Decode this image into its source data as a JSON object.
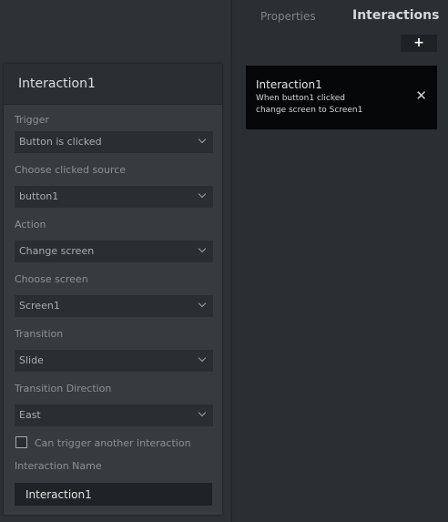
{
  "tabs": {
    "properties": "Properties",
    "interactions": "Interactions"
  },
  "add_button": {
    "label": "+",
    "icon": "plus-icon"
  },
  "interactions": [
    {
      "title": "Interaction1",
      "desc_line1": "When button1 clicked",
      "desc_line2": "change screen to Screen1",
      "close_label": "✕"
    }
  ],
  "editor": {
    "title": "Interaction1",
    "trigger": {
      "label": "Trigger",
      "value": "Button is clicked"
    },
    "source": {
      "label": "Choose clicked source",
      "value": "button1"
    },
    "action": {
      "label": "Action",
      "value": "Change screen"
    },
    "screen": {
      "label": "Choose screen",
      "value": "Screen1"
    },
    "transition": {
      "label": "Transition",
      "value": "Slide"
    },
    "direction": {
      "label": "Transition Direction",
      "value": "East"
    },
    "chain_checkbox": {
      "label": "Can trigger another interaction",
      "checked": false
    },
    "name": {
      "label": "Interaction Name",
      "value": "Interaction1"
    }
  },
  "colors": {
    "panel": "#373b40",
    "header": "#2b2e32",
    "card": "#050607",
    "background": "#2c2f33"
  }
}
